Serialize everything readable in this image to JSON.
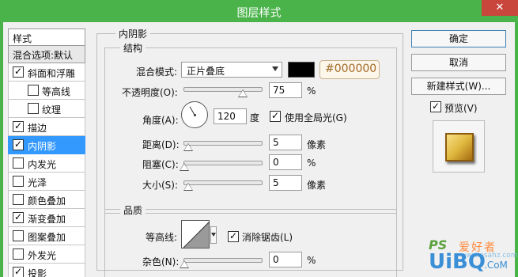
{
  "window": {
    "title": "图层样式",
    "close_glyph": "✕"
  },
  "left_list": {
    "style_header": "样式",
    "blend_options": "混合选项:默认",
    "items": [
      {
        "label": "斜面和浮雕",
        "checked": true,
        "indent": false,
        "selected": false
      },
      {
        "label": "等高线",
        "checked": false,
        "indent": true,
        "selected": false
      },
      {
        "label": "纹理",
        "checked": false,
        "indent": true,
        "selected": false
      },
      {
        "label": "描边",
        "checked": true,
        "indent": false,
        "selected": false
      },
      {
        "label": "内阴影",
        "checked": true,
        "indent": false,
        "selected": true
      },
      {
        "label": "内发光",
        "checked": false,
        "indent": false,
        "selected": false
      },
      {
        "label": "光泽",
        "checked": false,
        "indent": false,
        "selected": false
      },
      {
        "label": "颜色叠加",
        "checked": false,
        "indent": false,
        "selected": false
      },
      {
        "label": "渐变叠加",
        "checked": true,
        "indent": false,
        "selected": false
      },
      {
        "label": "图案叠加",
        "checked": false,
        "indent": false,
        "selected": false
      },
      {
        "label": "外发光",
        "checked": false,
        "indent": false,
        "selected": false
      },
      {
        "label": "投影",
        "checked": true,
        "indent": false,
        "selected": false
      }
    ]
  },
  "panel": {
    "section_title": "内阴影",
    "structure": {
      "title": "结构",
      "blend_mode_label": "混合模式:",
      "blend_mode_value": "正片叠底",
      "color_hex": "#000000",
      "opacity_label": "不透明度(O):",
      "opacity_value": "75",
      "opacity_unit": "%",
      "opacity_fraction": 0.75,
      "angle_label": "角度(A):",
      "angle_value": "120",
      "angle_unit": "度",
      "global_light_label": "使用全局光(G)",
      "global_light_checked": true,
      "distance_label": "距离(D):",
      "distance_value": "5",
      "distance_unit": "像素",
      "choke_label": "阻塞(C):",
      "choke_value": "0",
      "choke_unit": "%",
      "size_label": "大小(S):",
      "size_value": "5",
      "size_unit": "像素"
    },
    "quality": {
      "title": "品质",
      "contour_label": "等高线:",
      "anti_alias_label": "消除锯齿(L)",
      "anti_alias_checked": true,
      "noise_label": "杂色(N):",
      "noise_value": "0",
      "noise_unit": "%"
    }
  },
  "buttons": {
    "ok": "确定",
    "cancel": "取消",
    "new_style": "新建样式(W)...",
    "preview_label": "预览(V)",
    "preview_checked": true
  },
  "watermark": {
    "ps": "PS",
    "cn": "爱好者",
    "brand": "UiBQ",
    "com": ".CoM",
    "site": "www.psahz.com"
  }
}
